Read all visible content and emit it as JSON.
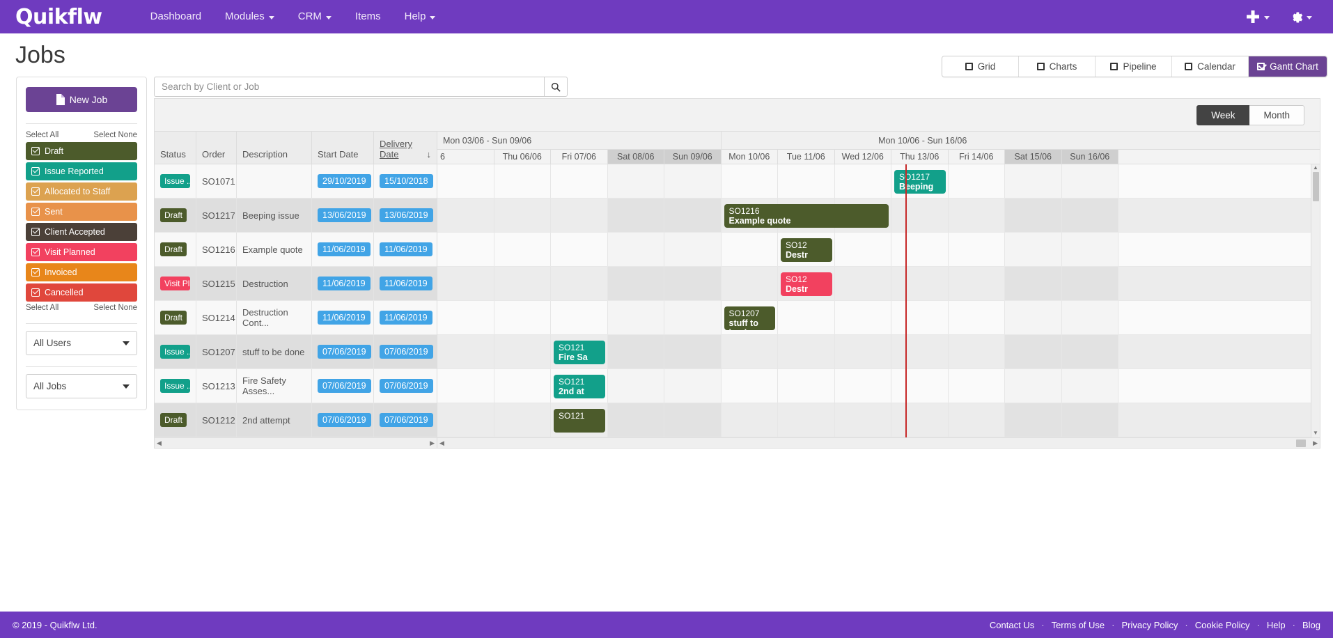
{
  "topnav": {
    "brand": "Quikflw",
    "links": [
      {
        "label": "Dashboard",
        "caret": false
      },
      {
        "label": "Modules",
        "caret": true
      },
      {
        "label": "CRM",
        "caret": true
      },
      {
        "label": "Items",
        "caret": false
      },
      {
        "label": "Help",
        "caret": true
      }
    ],
    "add_icon": "plus-icon",
    "settings_icon": "gear-icon"
  },
  "page": {
    "title": "Jobs",
    "views": [
      {
        "label": "Grid",
        "active": false
      },
      {
        "label": "Charts",
        "active": false
      },
      {
        "label": "Pipeline",
        "active": false
      },
      {
        "label": "Calendar",
        "active": false
      },
      {
        "label": "Gantt Chart",
        "active": true
      }
    ]
  },
  "sidebar": {
    "new_job_label": "New Job",
    "select_all": "Select All",
    "select_none": "Select None",
    "statuses": [
      {
        "label": "Draft",
        "color": "#4c5b2b"
      },
      {
        "label": "Issue Reported",
        "color": "#12a08a"
      },
      {
        "label": "Allocated to Staff",
        "color": "#dca250"
      },
      {
        "label": "Sent",
        "color": "#e8924a"
      },
      {
        "label": "Client Accepted",
        "color": "#4b4038"
      },
      {
        "label": "Visit Planned",
        "color": "#f2415f"
      },
      {
        "label": "Invoiced",
        "color": "#e8861a"
      },
      {
        "label": "Cancelled",
        "color": "#e0473c"
      }
    ],
    "user_filter": "All Users",
    "job_filter": "All Jobs"
  },
  "search": {
    "placeholder": "Search by Client or Job",
    "value": "",
    "icon": "search-icon"
  },
  "gantt": {
    "scale_buttons": [
      {
        "label": "Week",
        "active": true
      },
      {
        "label": "Month",
        "active": false
      }
    ],
    "columns": [
      "Status",
      "Order",
      "Description",
      "Start Date",
      "Delivery Date"
    ],
    "sorted_column": "Delivery Date",
    "sort_arrow": "↓",
    "week_groups": [
      {
        "label": "Mon 03/06 - Sun 09/06",
        "align": "left"
      },
      {
        "label": "Mon 10/06 - Sun 16/06",
        "align": "center"
      }
    ],
    "days": [
      {
        "label": "6",
        "weekend": false,
        "partial": true
      },
      {
        "label": "Thu 06/06",
        "weekend": false
      },
      {
        "label": "Fri 07/06",
        "weekend": false
      },
      {
        "label": "Sat 08/06",
        "weekend": true
      },
      {
        "label": "Sun 09/06",
        "weekend": true
      },
      {
        "label": "Mon 10/06",
        "weekend": false
      },
      {
        "label": "Tue 11/06",
        "weekend": false
      },
      {
        "label": "Wed 12/06",
        "weekend": false
      },
      {
        "label": "Thu 13/06",
        "weekend": false
      },
      {
        "label": "Fri 14/06",
        "weekend": false
      },
      {
        "label": "Sat 15/06",
        "weekend": true
      },
      {
        "label": "Sun 16/06",
        "weekend": true
      }
    ],
    "rows": [
      {
        "status": "Issue ...",
        "status_color": "#12a08a",
        "order": "SO1071",
        "description": "",
        "start_date": "29/10/2019",
        "delivery_date": "15/10/2018",
        "bar": {
          "order": "SO1217",
          "title": "Beeping",
          "color": "#12a08a",
          "day_index": 8,
          "day_span": 1
        }
      },
      {
        "status": "Draft",
        "status_color": "#4c5b2b",
        "order": "SO1217",
        "description": "Beeping issue",
        "start_date": "13/06/2019",
        "delivery_date": "13/06/2019",
        "bar": {
          "order": "SO1216",
          "title": "Example quote",
          "color": "#4c5b2b",
          "day_index": 5,
          "day_span": 3
        }
      },
      {
        "status": "Draft",
        "status_color": "#4c5b2b",
        "order": "SO1216",
        "description": "Example quote",
        "start_date": "11/06/2019",
        "delivery_date": "11/06/2019",
        "bar": {
          "order": "SO12",
          "title": "Destr",
          "color": "#4c5b2b",
          "day_index": 6,
          "day_span": 1
        }
      },
      {
        "status": "Visit Pl...",
        "status_color": "#f2415f",
        "order": "SO1215",
        "description": "Destruction",
        "start_date": "11/06/2019",
        "delivery_date": "11/06/2019",
        "bar": {
          "order": "SO12",
          "title": "Destr",
          "color": "#f2415f",
          "day_index": 6,
          "day_span": 1
        }
      },
      {
        "status": "Draft",
        "status_color": "#4c5b2b",
        "order": "SO1214",
        "description": "Destruction Cont...",
        "start_date": "11/06/2019",
        "delivery_date": "11/06/2019",
        "bar": {
          "order": "SO1207",
          "title": "stuff to be don",
          "color": "#4c5b2b",
          "day_index": 5,
          "day_span": 1
        }
      },
      {
        "status": "Issue ...",
        "status_color": "#12a08a",
        "order": "SO1207",
        "description": "stuff to be done",
        "start_date": "07/06/2019",
        "delivery_date": "07/06/2019",
        "bar": {
          "order": "SO121",
          "title": "Fire Sa",
          "color": "#12a08a",
          "day_index": 2,
          "day_span": 1
        }
      },
      {
        "status": "Issue ...",
        "status_color": "#12a08a",
        "order": "SO1213",
        "description": "Fire Safety Asses...",
        "start_date": "07/06/2019",
        "delivery_date": "07/06/2019",
        "bar": {
          "order": "SO121",
          "title": "2nd at",
          "color": "#12a08a",
          "day_index": 2,
          "day_span": 1
        }
      },
      {
        "status": "Draft",
        "status_color": "#4c5b2b",
        "order": "SO1212",
        "description": "2nd attempt",
        "start_date": "07/06/2019",
        "delivery_date": "07/06/2019",
        "bar": {
          "order": "SO121",
          "title": "",
          "color": "#4c5b2b",
          "day_index": 2,
          "day_span": 1
        }
      }
    ],
    "today_marker_color": "#c62828"
  },
  "footer": {
    "copyright": "© 2019 - Quikflw Ltd.",
    "links": [
      "Contact Us",
      "Terms of Use",
      "Privacy Policy",
      "Cookie Policy",
      "Help",
      "Blog"
    ]
  },
  "colors": {
    "brand_purple": "#6f3bbf",
    "button_purple": "#6b4394",
    "date_pill_blue": "#41a4e6"
  }
}
